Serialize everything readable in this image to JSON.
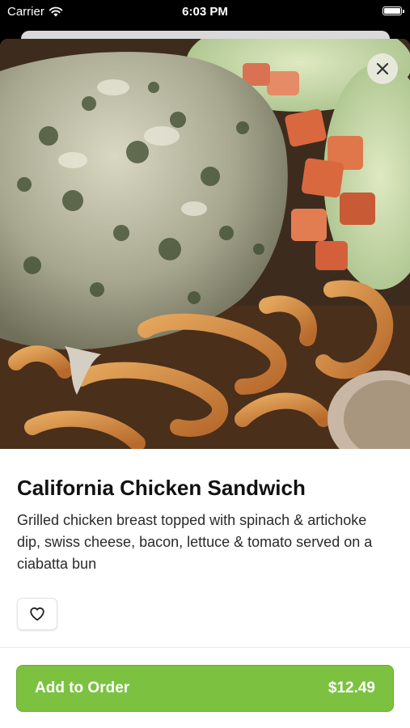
{
  "status_bar": {
    "carrier": "Carrier",
    "time": "6:03 PM"
  },
  "item": {
    "name": "California Chicken Sandwich",
    "description": "Grilled chicken breast topped with spinach & artichoke dip, swiss cheese, bacon, lettuce & tomato served on a ciabatta bun"
  },
  "icons": {
    "close": "close-icon",
    "favorite": "heart-outline-icon",
    "wifi": "wifi-icon",
    "battery": "battery-icon"
  },
  "order_button": {
    "label": "Add to Order",
    "price": "$12.49"
  },
  "colors": {
    "accent": "#7cc240",
    "text_primary": "#111111",
    "text_secondary": "#2a2a2a"
  }
}
